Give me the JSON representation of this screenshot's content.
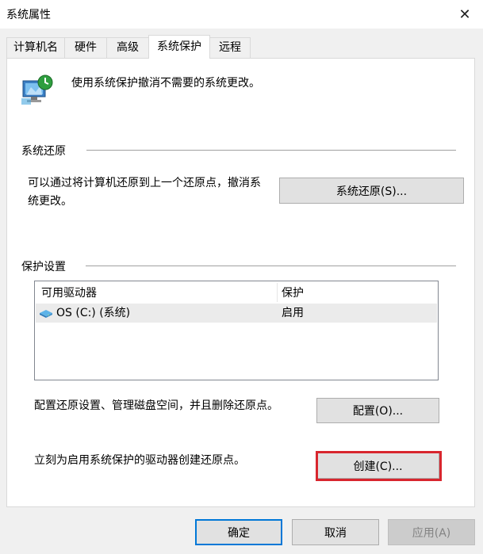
{
  "window": {
    "title": "系统属性",
    "close_glyph": "✕"
  },
  "tabs": [
    {
      "label": "计算机名",
      "active": false
    },
    {
      "label": "硬件",
      "active": false
    },
    {
      "label": "高级",
      "active": false
    },
    {
      "label": "系统保护",
      "active": true
    },
    {
      "label": "远程",
      "active": false
    }
  ],
  "info": {
    "icon": "system-protection-icon",
    "text": "使用系统保护撤消不需要的系统更改。"
  },
  "restore": {
    "group_label": "系统还原",
    "description_line1": "可以通过将计算机还原到上一个还原点，撤消系",
    "description_line2": "统更改。",
    "button_label": "系统还原(S)..."
  },
  "protection": {
    "group_label": "保护设置",
    "columns": {
      "drive": "可用驱动器",
      "protection": "保护"
    },
    "drives": [
      {
        "icon": "drive-icon",
        "name": "OS (C:) (系统)",
        "protection": "启用"
      }
    ],
    "configure_text": "配置还原设置、管理磁盘空间，并且删除还原点。",
    "configure_button": "配置(O)...",
    "create_text": "立刻为启用系统保护的驱动器创建还原点。",
    "create_button": "创建(C)...",
    "highlight_color": "#d8262e"
  },
  "footer": {
    "ok": "确定",
    "cancel": "取消",
    "apply": "应用(A)"
  },
  "colors": {
    "focus_border": "#0078d7",
    "list_border": "#828790",
    "selected_row": "#ebebeb"
  }
}
